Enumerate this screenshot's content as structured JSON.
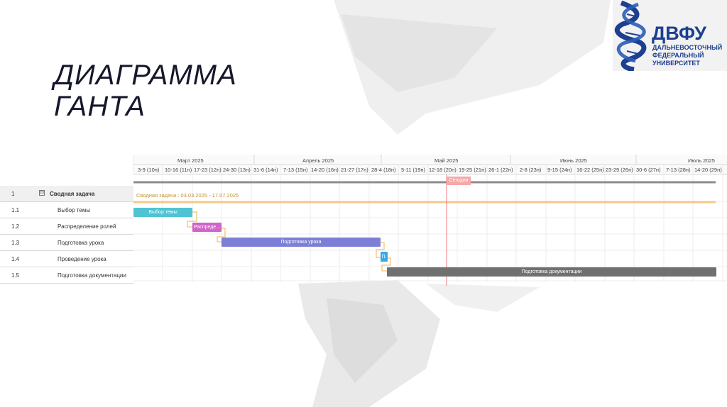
{
  "slide": {
    "title_line1": "ДИАГРАММА",
    "title_line2": "ГАНТА"
  },
  "logo": {
    "abbr": "ДВФУ",
    "line1": "ДАЛЬНЕВОСТОЧНЫЙ",
    "line2": "ФЕДЕРАЛЬНЫЙ",
    "line3": "УНИВЕРСИТЕТ"
  },
  "gantt": {
    "months": [
      "Март 2025",
      "Апрель 2025",
      "Май 2025",
      "Июнь 2025",
      "Июль 2025"
    ],
    "weeks": [
      "3-9 (10н)",
      "10-16 (11н)",
      "17-23 (12н)",
      "24-30 (13н)",
      "31-6 (14н)",
      "7-13 (15н)",
      "14-20 (16н)",
      "21-27 (17н)",
      "28-4 (18н)",
      "5-11 (19н)",
      "12-18 (20н)",
      "19-25 (21н)",
      "26-1 (22н)",
      "2-8 (23н)",
      "9-15 (24н)",
      "16-22 (25н)",
      "23-29 (26н)",
      "30-6 (27н)",
      "7-13 (28н)",
      "14-20 (29н)"
    ],
    "today_label": "Сегодня",
    "summary_bar_text": "Сводная задача : 03.03.2025 - 17.07.2025",
    "toggle_symbol": "⊟",
    "rows": [
      {
        "num": "1",
        "name": "Сводная задача"
      },
      {
        "num": "1.1",
        "name": "Выбор темы"
      },
      {
        "num": "1.2",
        "name": "Распределение ролей"
      },
      {
        "num": "1.3",
        "name": "Подготовка урока"
      },
      {
        "num": "1.4",
        "name": "Проведение урока"
      },
      {
        "num": "1.5",
        "name": "Подготовка документации"
      }
    ],
    "bars": [
      {
        "label": "Выбор темы",
        "color": "#4fc3d3"
      },
      {
        "label": "Распреде...",
        "color": "#d064c8"
      },
      {
        "label": "Подготовка урока",
        "color": "#7c7fd6"
      },
      {
        "label": "П.",
        "color": "#38a9e6"
      },
      {
        "label": "Подготовка документации",
        "color": "#707070"
      }
    ],
    "colors": {
      "summary_line": "#f3c98a",
      "progress_line": "#8c8c8c",
      "today_line": "#f07a7a",
      "connector": "#f0b44a"
    }
  }
}
